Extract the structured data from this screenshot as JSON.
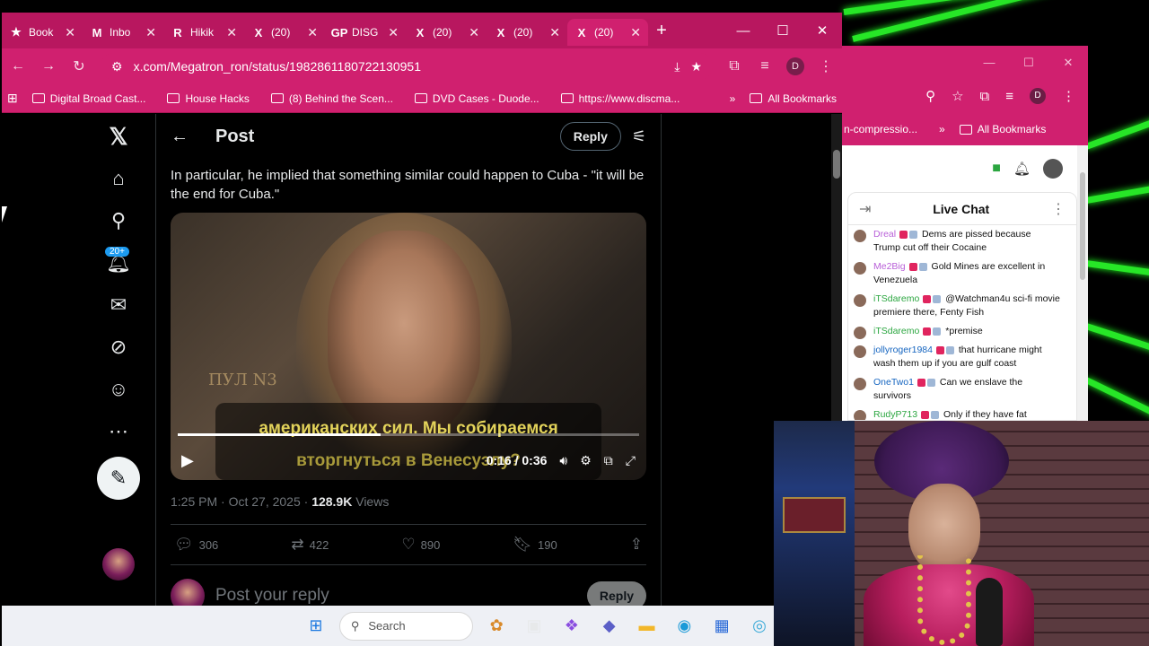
{
  "tabs": [
    {
      "label": "Book",
      "icon": "★",
      "active": false
    },
    {
      "label": "Inbo",
      "icon": "M",
      "active": false
    },
    {
      "label": "Hikik",
      "icon": "R",
      "active": false
    },
    {
      "label": "(20)",
      "icon": "X",
      "active": false
    },
    {
      "label": "DISG",
      "icon": "GP",
      "active": false
    },
    {
      "label": "(20)",
      "icon": "X",
      "active": false
    },
    {
      "label": "(20)",
      "icon": "X",
      "active": false
    },
    {
      "label": "(20)",
      "icon": "X",
      "active": true
    }
  ],
  "address": "x.com/Megatron_ron/status/1982861180722130951",
  "profile_initial": "D",
  "bookmarks": [
    {
      "label": "Digital Broad Cast..."
    },
    {
      "label": "House Hacks"
    },
    {
      "label": "(8) Behind the Scen..."
    },
    {
      "label": "DVD Cases - Duode..."
    },
    {
      "label": "https://www.discma..."
    }
  ],
  "all_bookmarks": "All Bookmarks",
  "more": "»",
  "notif_badge": "20+",
  "post": {
    "header_title": "Post",
    "reply_label": "Reply",
    "text": "In particular, he implied that something similar could happen to Cuba - \"it will be the end for Cuba.\"",
    "video": {
      "watermark": "ПУЛ N3",
      "subtitle_line1": "американских сил. Мы собираемся",
      "subtitle_line2": "вторгнуться в Венесуэлу?",
      "time": "0:16 / 0:36",
      "progress_fraction": 0.44
    },
    "time": "1:25 PM · Oct 27, 2025 · ",
    "views_count": "128.9K",
    "views_label": " Views",
    "replies": "306",
    "reposts": "422",
    "likes": "890",
    "bookmarks": "190",
    "reply_placeholder": "Post your reply",
    "reply_button": "Reply"
  },
  "second_window": {
    "bookmark_partial": "n-compressio...",
    "more": "»",
    "all_bookmarks": "All Bookmarks",
    "profile_initial": "D",
    "chat_title": "Live Chat",
    "messages": [
      {
        "user": "Dreal",
        "text": "Dems are pissed because Trump cut off their Cocaine",
        "color": "#b85fd8"
      },
      {
        "user": "Me2Big",
        "text": "Gold Mines are excellent in Venezuela",
        "color": "#b85fd8"
      },
      {
        "user": "iTSdaremo",
        "text": "@Watchman4u sci-fi movie premiere there, Fenty Fish",
        "color": "#2ba640"
      },
      {
        "user": "iTSdaremo",
        "text": "*premise",
        "color": "#2ba640"
      },
      {
        "user": "jollyroger1984",
        "text": "that hurricane might wash them up if you are gulf coast",
        "color": "#1565c0"
      },
      {
        "user": "OneTwo1",
        "text": "Can we enslave the survivors",
        "color": "#1565c0"
      },
      {
        "user": "RudyP713",
        "text": "Only if they have fat",
        "color": "#2ba640"
      }
    ]
  },
  "taskbar": {
    "search_label": "Search"
  }
}
